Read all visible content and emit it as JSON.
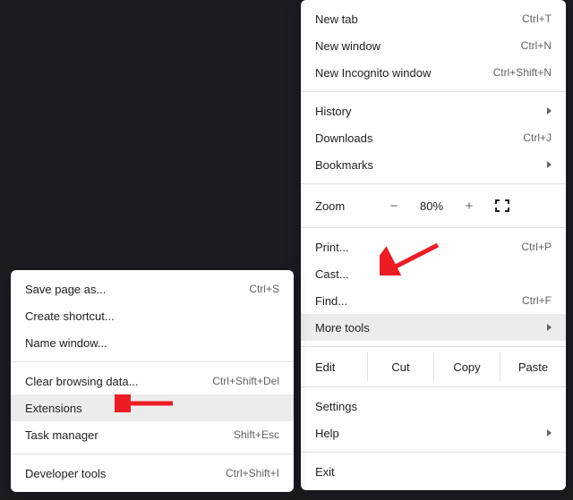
{
  "main_menu": {
    "new_tab": {
      "label": "New tab",
      "shortcut": "Ctrl+T"
    },
    "new_window": {
      "label": "New window",
      "shortcut": "Ctrl+N"
    },
    "new_incognito": {
      "label": "New Incognito window",
      "shortcut": "Ctrl+Shift+N"
    },
    "history": {
      "label": "History"
    },
    "downloads": {
      "label": "Downloads",
      "shortcut": "Ctrl+J"
    },
    "bookmarks": {
      "label": "Bookmarks"
    },
    "zoom": {
      "label": "Zoom",
      "minus": "−",
      "value": "80%",
      "plus": "+"
    },
    "print": {
      "label": "Print...",
      "shortcut": "Ctrl+P"
    },
    "cast": {
      "label": "Cast..."
    },
    "find": {
      "label": "Find...",
      "shortcut": "Ctrl+F"
    },
    "more_tools": {
      "label": "More tools"
    },
    "edit": {
      "label": "Edit",
      "cut": "Cut",
      "copy": "Copy",
      "paste": "Paste"
    },
    "settings": {
      "label": "Settings"
    },
    "help": {
      "label": "Help"
    },
    "exit": {
      "label": "Exit"
    }
  },
  "sub_menu": {
    "save_page": {
      "label": "Save page as...",
      "shortcut": "Ctrl+S"
    },
    "create_shortcut": {
      "label": "Create shortcut..."
    },
    "name_window": {
      "label": "Name window..."
    },
    "clear_data": {
      "label": "Clear browsing data...",
      "shortcut": "Ctrl+Shift+Del"
    },
    "extensions": {
      "label": "Extensions"
    },
    "task_manager": {
      "label": "Task manager",
      "shortcut": "Shift+Esc"
    },
    "developer_tools": {
      "label": "Developer tools",
      "shortcut": "Ctrl+Shift+I"
    }
  },
  "annotations": {
    "arrow_color": "#ed1c24"
  }
}
